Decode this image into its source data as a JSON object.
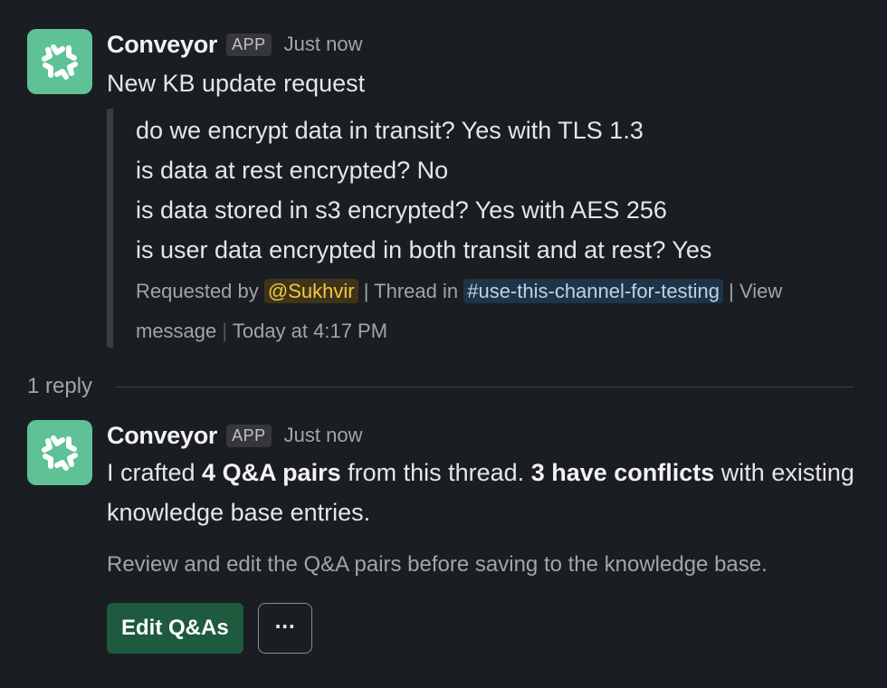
{
  "colors": {
    "background": "#1a1d21",
    "avatar": "#5fc196",
    "primary_button": "#1d5a3e",
    "mention_bg": "#3f3419",
    "mention_text": "#f2c744",
    "channel_bg": "#1d3547",
    "channel_text": "#b9d4e8"
  },
  "message1": {
    "avatar_icon": "conveyor-logo-icon",
    "sender": "Conveyor",
    "badge": "APP",
    "time": "Just now",
    "title": "New KB update request",
    "quote": {
      "lines": [
        "do we encrypt data in transit? Yes with TLS 1.3",
        "is data at rest encrypted? No",
        "is data stored in s3 encrypted? Yes with AES 256",
        "is user data encrypted in both transit and at rest? Yes"
      ],
      "requested_by_label": "Requested by",
      "mention": "@Sukhvir",
      "thread_in_label": "| Thread in",
      "channel": "#use-this-channel-for-testing",
      "view_message": "View message",
      "pipe": "|",
      "posted_time": "Today at 4:17 PM"
    }
  },
  "thread": {
    "reply_count": "1 reply"
  },
  "message2": {
    "avatar_icon": "conveyor-logo-icon",
    "sender": "Conveyor",
    "badge": "APP",
    "time": "Just now",
    "text_part1": "I crafted ",
    "text_bold1": "4 Q&A pairs",
    "text_part2": " from this thread. ",
    "text_bold2": "3 have conflicts",
    "text_part3": " with existing knowledge base entries.",
    "hint": "Review and edit the Q&A pairs before saving to the knowledge base.",
    "edit_button": "Edit Q&As",
    "more_button": "···",
    "more_icon": "ellipsis-icon"
  }
}
